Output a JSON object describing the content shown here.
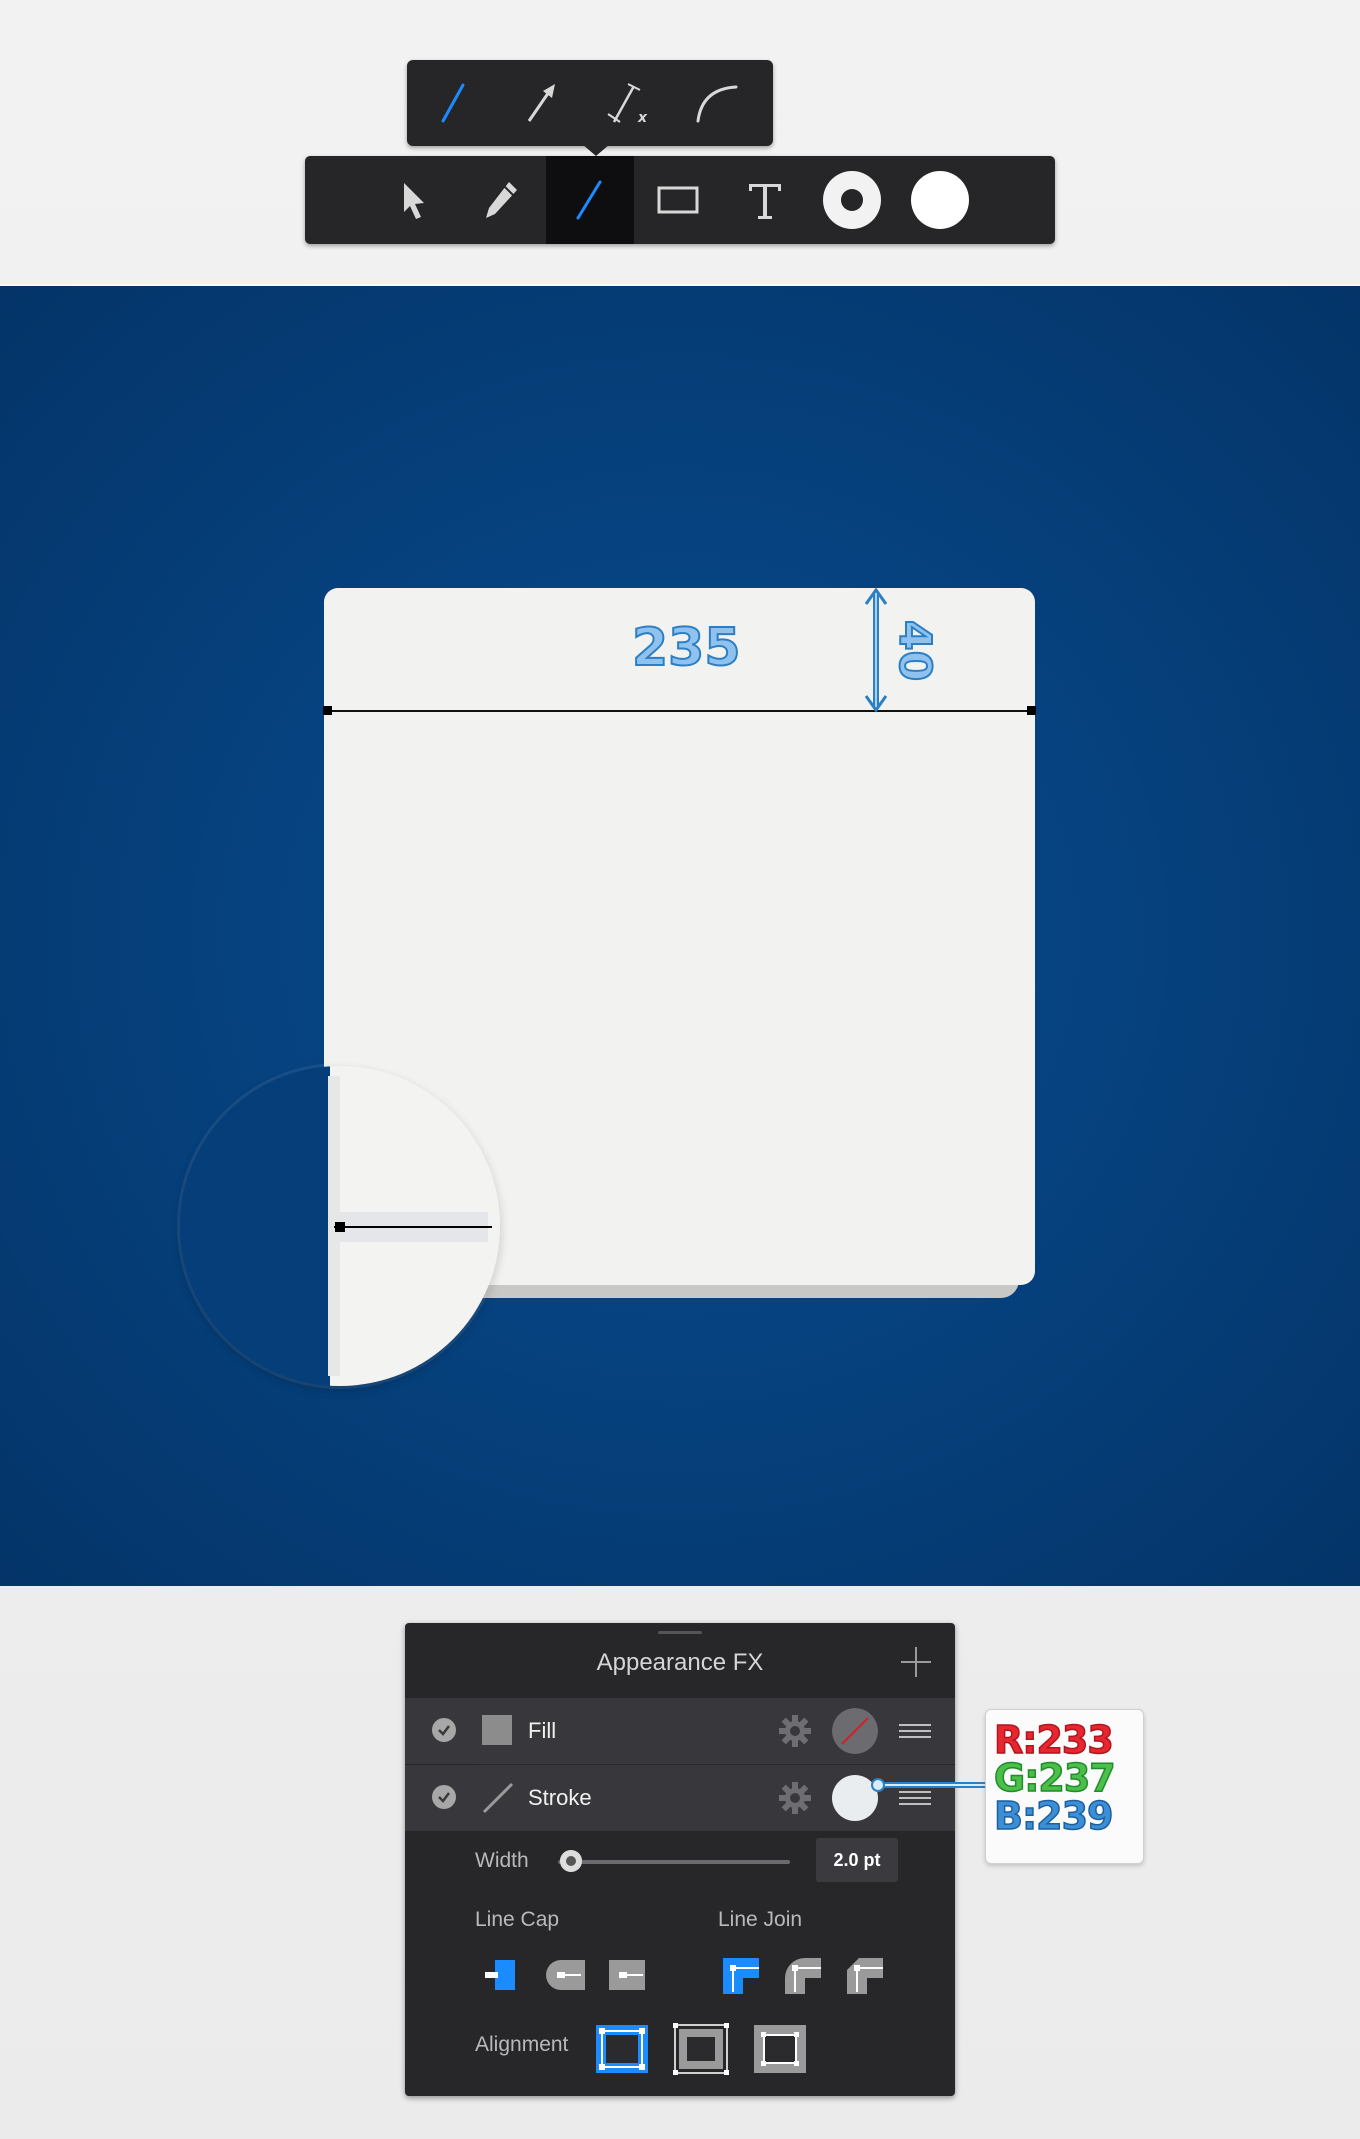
{
  "toolbar": {
    "subtools": [
      "line-tool",
      "arrow-tool",
      "dimension-tool",
      "arc-tool"
    ],
    "tools": [
      "selection-tool",
      "pencil-tool",
      "line-tool",
      "rectangle-tool",
      "text-tool",
      "stroke-color",
      "fill-color"
    ],
    "active_tool": "line-tool",
    "accent": "#1a8cff"
  },
  "canvas": {
    "background": "#06427f",
    "dimension_width": "235",
    "dimension_height": "40"
  },
  "panel": {
    "title": "Appearance FX",
    "fill": {
      "label": "Fill",
      "swatch": "none"
    },
    "stroke": {
      "label": "Stroke",
      "swatch": "#e9edef"
    },
    "width_label": "Width",
    "width_value": "2.0 pt",
    "line_cap_label": "Line Cap",
    "line_join_label": "Line Join",
    "alignment_label": "Alignment",
    "selected_cap": "butt",
    "selected_join": "miter",
    "selected_alignment": "center"
  },
  "callout": {
    "r": "R:233",
    "g": "G:237",
    "b": "B:239"
  }
}
